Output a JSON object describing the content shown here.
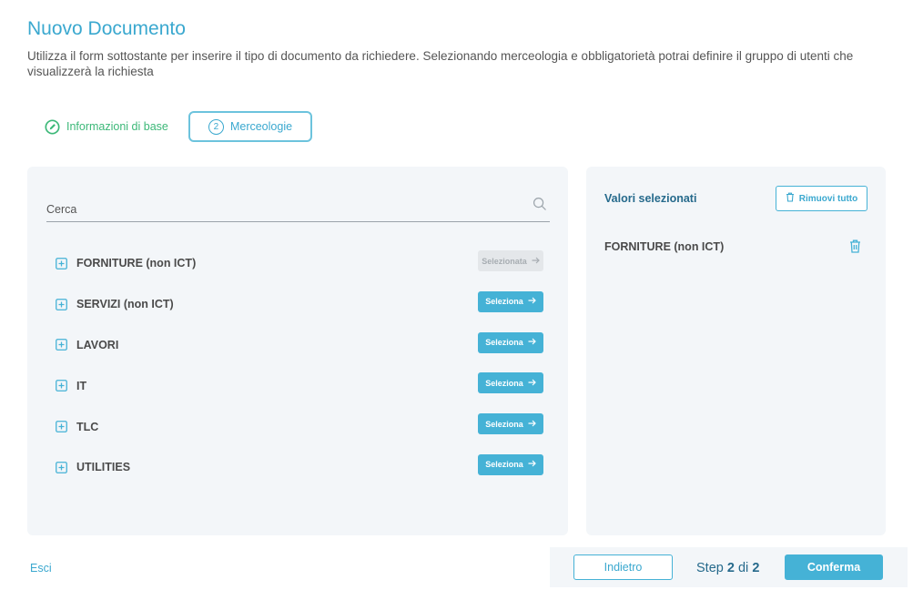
{
  "header": {
    "title": "Nuovo Documento",
    "description": "Utilizza il form sottostante per inserire il tipo di documento da richiedere. Selezionando merceologia e obbligatorietà potrai definire il gruppo di utenti che visualizzerà la richiesta"
  },
  "steps": [
    {
      "label": "Informazioni di base",
      "icon": "pencil-icon",
      "state": "completed"
    },
    {
      "label": "Merceologie",
      "number": "2",
      "state": "active"
    }
  ],
  "search": {
    "placeholder": "Cerca",
    "value": ""
  },
  "categories": [
    {
      "label": "FORNITURE (non ICT)",
      "button": "Selezionata",
      "disabled": true
    },
    {
      "label": "SERVIZI (non ICT)",
      "button": "Seleziona",
      "disabled": false
    },
    {
      "label": "LAVORI",
      "button": "Seleziona",
      "disabled": false
    },
    {
      "label": "IT",
      "button": "Seleziona",
      "disabled": false
    },
    {
      "label": "TLC",
      "button": "Seleziona",
      "disabled": false
    },
    {
      "label": "UTILITIES",
      "button": "Seleziona",
      "disabled": false
    }
  ],
  "selected": {
    "title": "Valori selezionati",
    "remove_all_label": "Rimuovi tutto",
    "items": [
      "FORNITURE (non ICT)"
    ]
  },
  "footer": {
    "exit_label": "Esci",
    "back_label": "Indietro",
    "step_word": "Step",
    "step_current": "2",
    "step_of": "di",
    "step_total": "2",
    "confirm_label": "Conferma"
  },
  "colors": {
    "accent": "#45b2d6",
    "title": "#3aa8cf",
    "success": "#3cb878",
    "dark_accent": "#266a8c",
    "panel_bg": "#f3f6f9"
  }
}
